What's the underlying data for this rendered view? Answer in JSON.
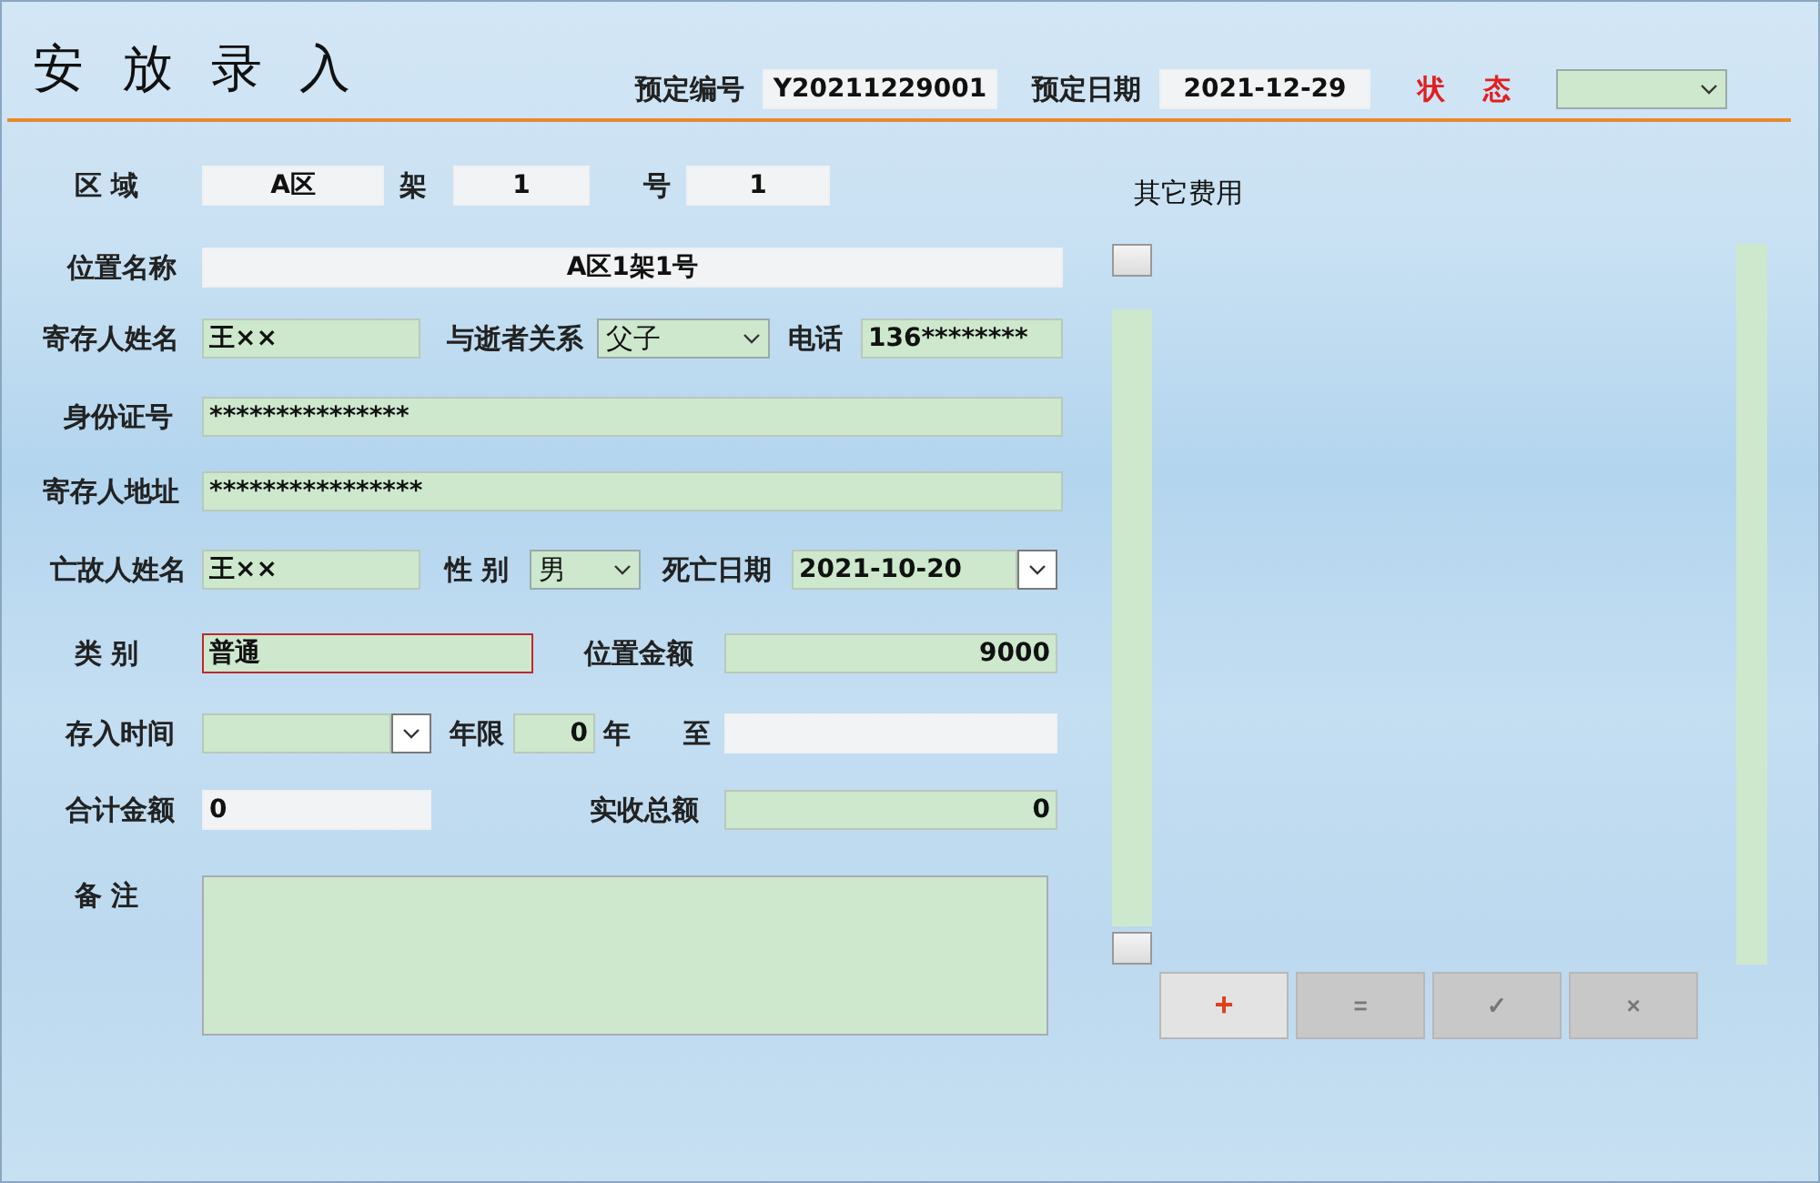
{
  "title": "安 放 录 入",
  "header": [
    {
      "kind": "label",
      "text": "预定编号"
    },
    {
      "kind": "field",
      "value": "Y20211229001",
      "readonly": true
    },
    {
      "kind": "label",
      "text": "预定日期"
    },
    {
      "kind": "field",
      "value": "2021-12-29",
      "readonly": true
    },
    {
      "kind": "status_label",
      "text": "状 态"
    },
    {
      "kind": "select",
      "readonly": false
    }
  ],
  "rows": [
    [
      {
        "kind": "label",
        "text": "区 域"
      },
      {
        "kind": "field",
        "value": "A区",
        "readonly": true
      },
      {
        "kind": "label",
        "text": "架"
      },
      {
        "kind": "field",
        "value": "1",
        "readonly": true
      },
      {
        "kind": "label",
        "text": "号"
      },
      {
        "kind": "field",
        "value": "1",
        "readonly": true
      }
    ],
    [
      {
        "kind": "label",
        "text": "位置名称"
      },
      {
        "kind": "field",
        "value": "A区1架1号",
        "readonly": true
      }
    ],
    [
      {
        "kind": "label",
        "text": "寄存人姓名"
      },
      {
        "kind": "field",
        "value": "王××",
        "readonly": false
      },
      {
        "kind": "label",
        "text": "与逝者关系"
      },
      {
        "kind": "select",
        "value": "父子",
        "readonly": false
      },
      {
        "kind": "label",
        "text": "电话"
      },
      {
        "kind": "field",
        "value": "136********",
        "readonly": false
      }
    ],
    [
      {
        "kind": "label",
        "text": "身份证号"
      },
      {
        "kind": "field",
        "value": "***************",
        "readonly": false
      }
    ],
    [
      {
        "kind": "label",
        "text": "寄存人地址"
      },
      {
        "kind": "field",
        "value": "****************",
        "readonly": false
      }
    ],
    [
      {
        "kind": "label",
        "text": "亡故人姓名"
      },
      {
        "kind": "field",
        "value": "王××",
        "readonly": false
      },
      {
        "kind": "label",
        "text": "性 别"
      },
      {
        "kind": "select",
        "value": "男",
        "readonly": false
      },
      {
        "kind": "label",
        "text": "死亡日期"
      },
      {
        "kind": "date",
        "value": "2021-10-20",
        "readonly": false
      }
    ],
    [
      {
        "kind": "label",
        "text": "类 别"
      },
      {
        "kind": "field",
        "value": "普通",
        "readonly": false,
        "highlighted": true
      },
      {
        "kind": "label",
        "text": "位置金额"
      },
      {
        "kind": "field",
        "value": "9000",
        "readonly": false
      }
    ],
    [
      {
        "kind": "label",
        "text": "存入时间"
      },
      {
        "kind": "date",
        "readonly": false
      },
      {
        "kind": "label",
        "text": "年限"
      },
      {
        "kind": "field",
        "value": "0",
        "readonly": false
      },
      {
        "kind": "label",
        "text": "年"
      },
      {
        "kind": "label",
        "text": "至"
      },
      {
        "kind": "field",
        "readonly": true
      }
    ],
    [
      {
        "kind": "label",
        "text": "合计金额"
      },
      {
        "kind": "field",
        "value": "0",
        "readonly": true
      },
      {
        "kind": "label",
        "text": "实收总额"
      },
      {
        "kind": "field",
        "value": "0",
        "readonly": false
      }
    ],
    [
      {
        "kind": "label",
        "text": "备 注"
      },
      {
        "kind": "textarea",
        "readonly": false
      }
    ]
  ],
  "other_fees": {
    "title": "其它费用"
  },
  "buttons": [
    {
      "symbol": "+",
      "disabled": false
    },
    {
      "symbol": "=",
      "disabled": true
    },
    {
      "symbol": "✓",
      "disabled": true
    },
    {
      "symbol": "×",
      "disabled": true
    }
  ]
}
